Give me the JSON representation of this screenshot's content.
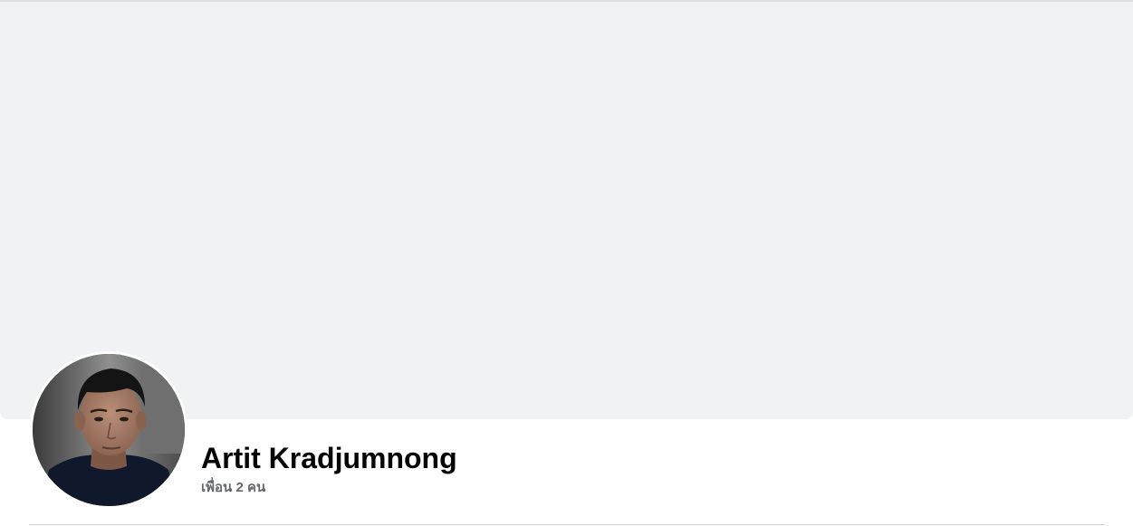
{
  "profile": {
    "name": "Artit Kradjumnong",
    "friends_count_text": "เพื่อน 2 คน"
  },
  "colors": {
    "cover": "#f0f2f5",
    "name": "#050505",
    "secondary_text": "#65676b"
  }
}
